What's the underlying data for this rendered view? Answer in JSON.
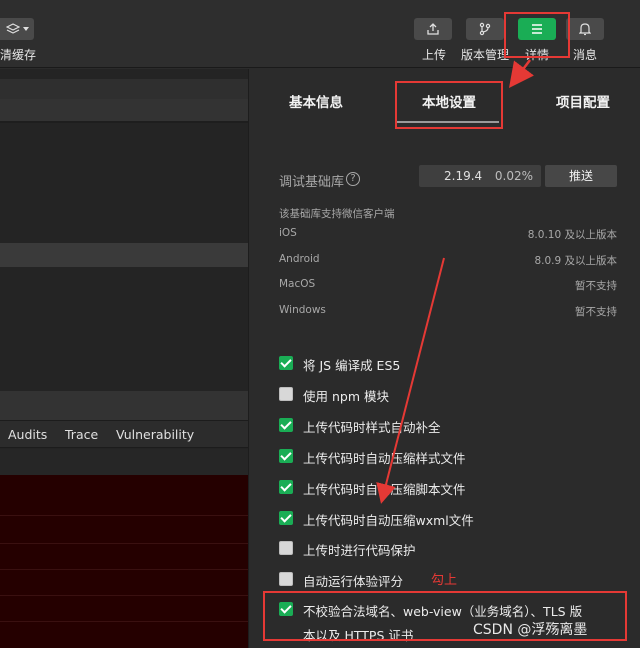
{
  "toolbar": {
    "left_label": "清缓存",
    "buttons": [
      {
        "icon": "upload-icon",
        "label": "上传"
      },
      {
        "icon": "branch-icon",
        "label": "版本管理"
      },
      {
        "icon": "menu-icon",
        "label": "详情"
      },
      {
        "icon": "bell-icon",
        "label": "消息"
      }
    ]
  },
  "left_panel": {
    "tabs": [
      "Audits",
      "Trace",
      "Vulnerability"
    ]
  },
  "tabs": [
    "基本信息",
    "本地设置",
    "项目配置"
  ],
  "debug_lib": {
    "label": "调试基础库",
    "version": "2.19.4",
    "percent": "0.02%",
    "push_label": "推送"
  },
  "support": {
    "title": "该基础库支持微信客户端",
    "rows": [
      {
        "platform": "iOS",
        "value": "8.0.10 及以上版本"
      },
      {
        "platform": "Android",
        "value": "8.0.9 及以上版本"
      },
      {
        "platform": "MacOS",
        "value": "暂不支持"
      },
      {
        "platform": "Windows",
        "value": "暂不支持"
      }
    ]
  },
  "options": [
    {
      "label": "将 JS 编译成 ES5",
      "checked": true
    },
    {
      "label": "使用 npm 模块",
      "checked": false
    },
    {
      "label": "上传代码时样式自动补全",
      "checked": true
    },
    {
      "label": "上传代码时自动压缩样式文件",
      "checked": true
    },
    {
      "label": "上传代码时自动压缩脚本文件",
      "checked": true
    },
    {
      "label": "上传代码时自动压缩wxml文件",
      "checked": true
    },
    {
      "label": "上传时进行代码保护",
      "checked": false
    },
    {
      "label": "自动运行体验评分",
      "checked": false
    },
    {
      "label": "不校验合法域名、web-view（业务域名）、TLS 版",
      "label_line2": "本以及 HTTPS 证书",
      "checked": true
    }
  ],
  "annotation": "勾上",
  "watermark": "CSDN @浮殇离墨",
  "colors": {
    "accent_green": "#1aad55",
    "annotation_red": "#e53935"
  }
}
